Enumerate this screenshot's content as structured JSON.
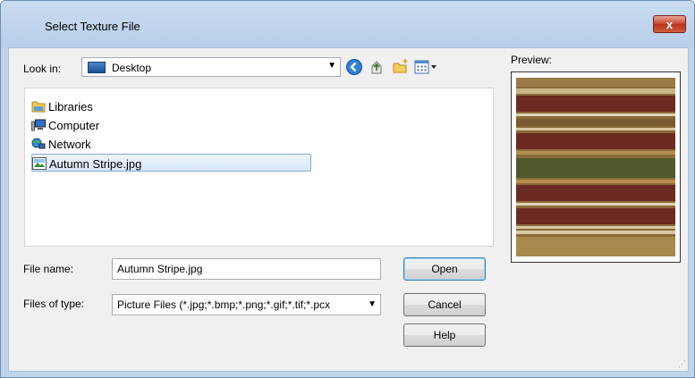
{
  "window": {
    "title": "Select Texture File",
    "close_glyph": "x"
  },
  "toolbar": {
    "look_in_label": "Look in:",
    "look_in_value": "Desktop",
    "look_in_icon": "desktop-icon",
    "buttons": [
      "back-icon",
      "up-folder-icon",
      "new-folder-icon",
      "view-menu-icon"
    ]
  },
  "file_list": {
    "items": [
      {
        "label": "Libraries",
        "icon": "libraries-icon"
      },
      {
        "label": "Computer",
        "icon": "computer-icon"
      },
      {
        "label": "Network",
        "icon": "network-icon"
      },
      {
        "label": "Autumn Stripe.jpg",
        "icon": "image-file-icon",
        "selected": true
      }
    ]
  },
  "form": {
    "file_name_label": "File name:",
    "file_name_value": "Autumn Stripe.jpg",
    "file_type_label": "Files of type:",
    "file_type_value": "Picture Files (*.jpg;*.bmp;*.png;*.gif;*.tif;*.pcx"
  },
  "buttons": {
    "open": "Open",
    "cancel": "Cancel",
    "help": "Help"
  },
  "preview": {
    "label": "Preview:",
    "texture_colors": [
      "#8a6a3a",
      "#6b2a22",
      "#4f5a2c",
      "#d8c7a3"
    ]
  },
  "colors": {
    "titlebar": "#c9dcf0",
    "client_background": "#f0f0f0",
    "close_button": "#c8452e",
    "selection": "#d7e7fb"
  }
}
